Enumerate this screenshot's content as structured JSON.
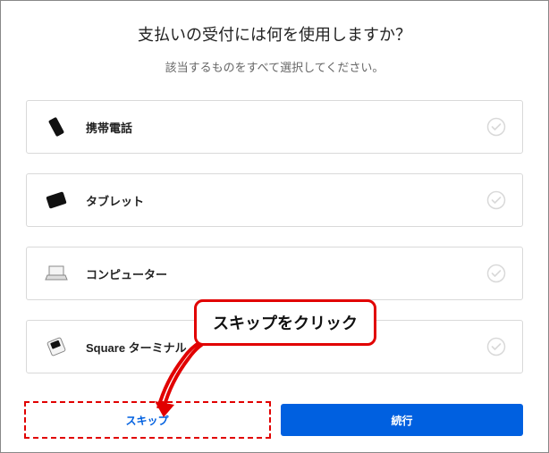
{
  "title": "支払いの受付には何を使用しますか？",
  "subtitle": "該当するものをすべて選択してください。",
  "options": [
    {
      "label": "携帯電話",
      "icon": "phone-icon"
    },
    {
      "label": "タブレット",
      "icon": "tablet-icon"
    },
    {
      "label": "コンピューター",
      "icon": "computer-icon"
    },
    {
      "label": "Square ターミナル",
      "icon": "terminal-icon"
    }
  ],
  "buttons": {
    "skip": "スキップ",
    "continue": "続行"
  },
  "annotation": {
    "callout_text": "スキップをクリック"
  }
}
